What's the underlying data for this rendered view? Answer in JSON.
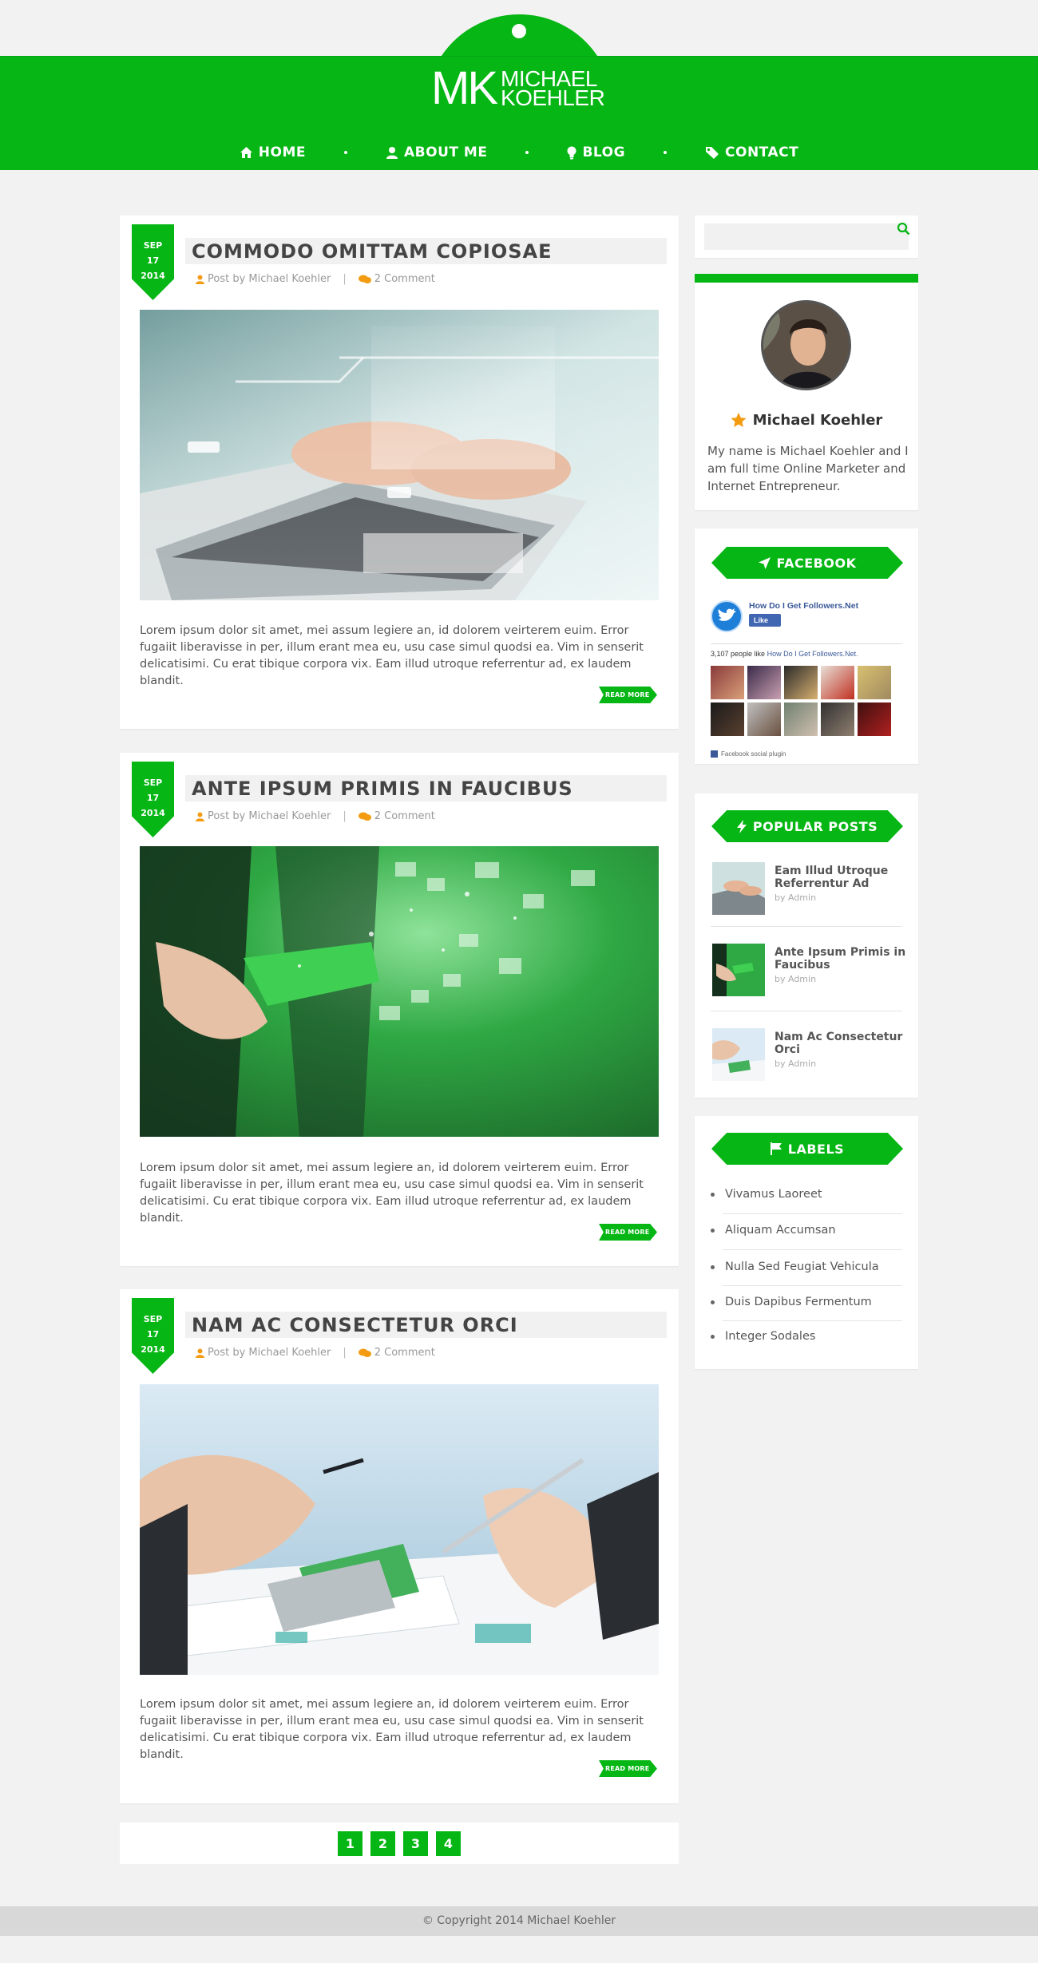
{
  "brand": {
    "initials": "MK",
    "name_line1": "MICHAEL",
    "name_line2": "KOEHLER"
  },
  "nav": [
    {
      "label": "HOME",
      "icon": "home-icon"
    },
    {
      "label": "ABOUT ME",
      "icon": "user-icon"
    },
    {
      "label": "BLOG",
      "icon": "lightbulb-icon"
    },
    {
      "label": "CONTACT",
      "icon": "tag-icon"
    }
  ],
  "posts": [
    {
      "date": {
        "month": "SEP",
        "day": "17",
        "year": "2014"
      },
      "title": "COMMODO OMITTAM COPIOSAE",
      "author": "Post by Michael Koehler",
      "comments": "2 Comment",
      "image": "laptop-typing-photo",
      "excerpt": "Lorem ipsum dolor sit amet, mei assum legiere an, id dolorem veirterem euim. Error fugaiit liberavisse in per, illum erant mea eu, usu case simul quodsi ea. Vim in senserit delicatisimi. Cu erat tibique corpora vix. Eam illud utroque referrentur ad, ex laudem blandit.",
      "read_more": "READ MORE"
    },
    {
      "date": {
        "month": "SEP",
        "day": "17",
        "year": "2014"
      },
      "title": "ANTE IPSUM PRIMIS IN FAUCIBUS",
      "author": "Post by Michael Koehler",
      "comments": "2 Comment",
      "image": "handshake-digital-photo",
      "excerpt": "Lorem ipsum dolor sit amet, mei assum legiere an, id dolorem veirterem euim. Error fugaiit liberavisse in per, illum erant mea eu, usu case simul quodsi ea. Vim in senserit delicatisimi. Cu erat tibique corpora vix. Eam illud utroque referrentur ad, ex laudem blandit.",
      "read_more": "READ MORE"
    },
    {
      "date": {
        "month": "SEP",
        "day": "17",
        "year": "2014"
      },
      "title": "NAM AC CONSECTETUR ORCI",
      "author": "Post by Michael Koehler",
      "comments": "2 Comment",
      "image": "calculator-documents-photo",
      "excerpt": "Lorem ipsum dolor sit amet, mei assum legiere an, id dolorem veirterem euim. Error fugaiit liberavisse in per, illum erant mea eu, usu case simul quodsi ea. Vim in senserit delicatisimi. Cu erat tibique corpora vix. Eam illud utroque referrentur ad, ex laudem blandit.",
      "read_more": "READ MORE"
    }
  ],
  "pagination": [
    "1",
    "2",
    "3",
    "4"
  ],
  "footer": {
    "copyright": "© Copyright 2014 Michael Koehler"
  },
  "sidebar": {
    "search": {
      "placeholder": "",
      "icon": "search-icon"
    },
    "about": {
      "name": "Michael Koehler",
      "bio": "My name is Michael Koehler and I am full time Online Marketer and Internet Entrepreneur."
    },
    "facebook": {
      "title": "FACEBOOK",
      "page_name": "How Do I Get Followers.Net",
      "like_label": "Like",
      "count_text": "3,107 people like",
      "count_page": "How Do I Get Followers.Net.",
      "plugin_text": "Facebook social plugin"
    },
    "popular": {
      "title": "POPULAR POSTS",
      "items": [
        {
          "title": "Eam Illud Utroque Referrentur Ad",
          "by": "by Admin"
        },
        {
          "title": "Ante Ipsum Primis in Faucibus",
          "by": "by Admin"
        },
        {
          "title": "Nam Ac Consectetur Orci",
          "by": "by Admin"
        }
      ]
    },
    "labels": {
      "title": "LABELS",
      "items": [
        "Vivamus Laoreet",
        "Aliquam Accumsan",
        "Nulla Sed Feugiat Vehicula",
        "Duis Dapibus Fermentum",
        "Integer Sodales"
      ]
    }
  },
  "colors": {
    "accent": "#05b614",
    "background": "#f2f2f2",
    "footer": "#d8d8d8"
  }
}
